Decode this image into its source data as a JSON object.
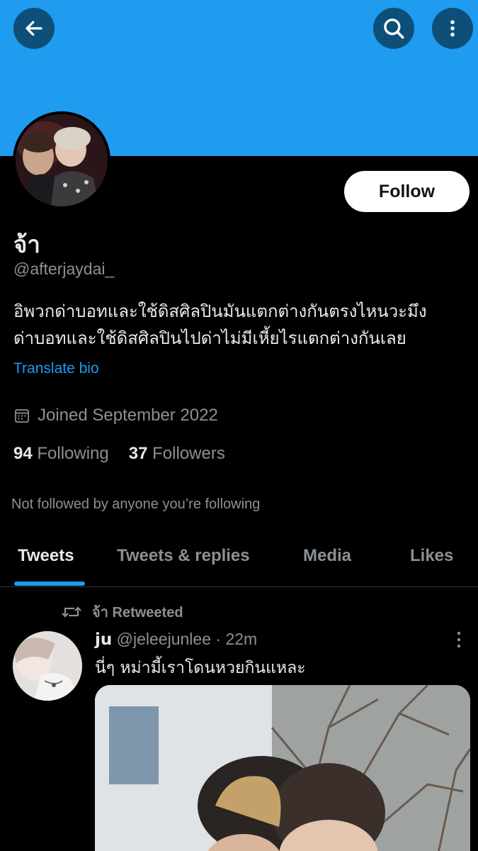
{
  "header": {
    "back_icon": "arrow-left-icon",
    "search_icon": "search-icon",
    "more_icon": "more-vertical-icon",
    "banner_color": "#1f9bf0"
  },
  "profile": {
    "display_name": "จ้า",
    "handle": "@afterjaydai_",
    "follow_label": "Follow",
    "bio_line1": "อิพวกด่าบอทและใช้ดิสศิลปินมันแตกต่างกันตรงไหนวะมึง",
    "bio_line2": "ด่าบอทและใช้ดิสศิลปินไปด่าไม่มีเหี้ยไรแตกต่างกันเลย",
    "translate_label": "Translate bio",
    "joined": "Joined September 2022",
    "following_count": "94",
    "following_label": "Following",
    "followers_count": "37",
    "followers_label": "Followers",
    "not_followed": "Not followed by anyone you’re following"
  },
  "tabs": [
    {
      "label": "Tweets",
      "active": true
    },
    {
      "label": "Tweets & replies",
      "active": false
    },
    {
      "label": "Media",
      "active": false
    },
    {
      "label": "Likes",
      "active": false
    }
  ],
  "tweet": {
    "retweet_label": "จ้า Retweeted",
    "author_name": "ju",
    "author_handle": "@jeleejunlee",
    "separator": "·",
    "time": "22m",
    "text": "นี่ๆ หม่ามี้เราโดนหวยกินแหละ"
  },
  "colors": {
    "accent": "#1d9bf0",
    "muted": "#8b9095",
    "text": "#e7e9ea"
  }
}
